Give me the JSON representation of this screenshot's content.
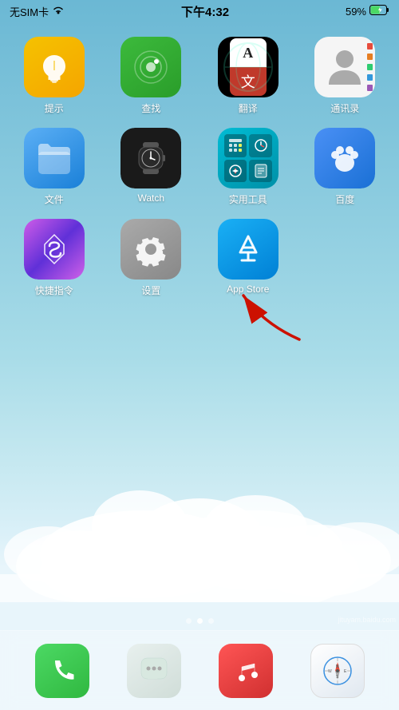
{
  "statusBar": {
    "carrier": "无SIM卡",
    "wifi": "wifi",
    "time": "下午4:32",
    "battery": "59%"
  },
  "apps": [
    {
      "id": "tishi",
      "label": "提示",
      "type": "tishi"
    },
    {
      "id": "chazhao",
      "label": "查找",
      "type": "chazhao"
    },
    {
      "id": "fanyi",
      "label": "翻译",
      "type": "fanyi"
    },
    {
      "id": "contacts",
      "label": "通讯录",
      "type": "contacts"
    },
    {
      "id": "wenjian",
      "label": "文件",
      "type": "wenjian"
    },
    {
      "id": "watch",
      "label": "Watch",
      "type": "watch"
    },
    {
      "id": "shiyong",
      "label": "实用工具",
      "type": "shiyong"
    },
    {
      "id": "baidu",
      "label": "百度",
      "type": "baidu"
    },
    {
      "id": "siri",
      "label": "快捷指令",
      "type": "siri"
    },
    {
      "id": "settings",
      "label": "设置",
      "type": "settings"
    },
    {
      "id": "appstore",
      "label": "App Store",
      "type": "appstore"
    }
  ],
  "dock": [
    {
      "id": "phone",
      "label": "电话",
      "type": "phone"
    },
    {
      "id": "message",
      "label": "信息",
      "type": "message"
    },
    {
      "id": "music",
      "label": "音乐",
      "type": "music"
    },
    {
      "id": "safari",
      "label": "Safari",
      "type": "safari"
    }
  ],
  "pageIndicator": {
    "dots": [
      false,
      true,
      false
    ]
  }
}
